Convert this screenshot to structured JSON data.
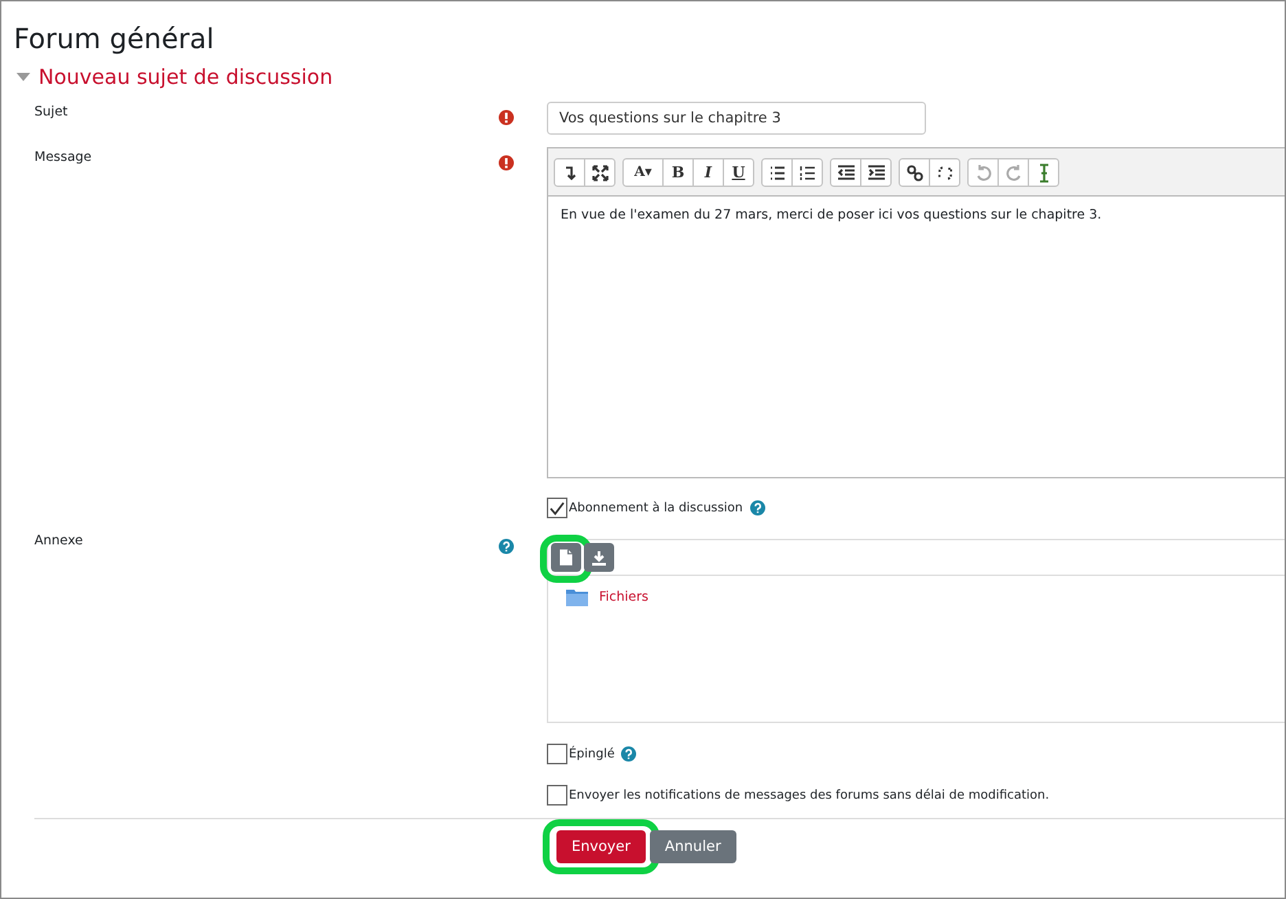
{
  "title": "Forum général",
  "section": {
    "label": "Nouveau sujet de discussion",
    "expanded": true
  },
  "subject": {
    "label": "Sujet",
    "required": true,
    "value": "Vos questions sur le chapitre 3"
  },
  "message": {
    "label": "Message",
    "required": true,
    "value": "En vue de l'examen du 27 mars, merci de poser ici vos questions sur le chapitre 3.",
    "toolbar": [
      [
        {
          "kind": "collapse"
        },
        {
          "kind": "fullscreen"
        }
      ],
      [
        {
          "kind": "font",
          "label": "A▾"
        },
        {
          "kind": "bold",
          "label": "B"
        },
        {
          "kind": "italic",
          "label": "I"
        },
        {
          "kind": "underline",
          "label": "U"
        }
      ],
      [
        {
          "kind": "bullets"
        },
        {
          "kind": "numbers"
        }
      ],
      [
        {
          "kind": "outdent"
        },
        {
          "kind": "indent"
        }
      ],
      [
        {
          "kind": "link"
        },
        {
          "kind": "unlink"
        }
      ],
      [
        {
          "kind": "undo",
          "disabled": true
        },
        {
          "kind": "redo",
          "disabled": true
        },
        {
          "kind": "cursor"
        }
      ]
    ]
  },
  "subscribe": {
    "label": "Abonnement à la discussion",
    "checked": true,
    "help": true
  },
  "attachment": {
    "label": "Annexe",
    "help": true,
    "buttons": [
      {
        "kind": "file",
        "highlighted": true
      },
      {
        "kind": "download",
        "highlighted": false
      }
    ],
    "folder": "Fichiers"
  },
  "options": [
    {
      "label": "Épinglé",
      "checked": false,
      "help": true
    },
    {
      "label": "Envoyer les notifications de messages des forums sans délai de modification.",
      "checked": false,
      "help": false
    }
  ],
  "actions": [
    {
      "label": "Envoyer",
      "kind": "primary",
      "highlighted": true
    },
    {
      "label": "Annuler",
      "kind": "secondary",
      "highlighted": false
    }
  ]
}
